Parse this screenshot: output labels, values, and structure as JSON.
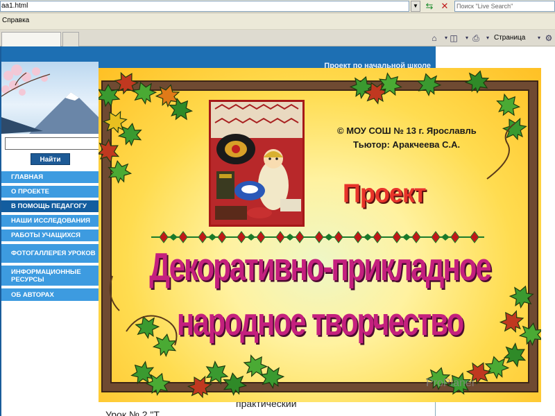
{
  "browser": {
    "address_value": "aa1.html",
    "search_placeholder": "Поиск \"Live Search\"",
    "menu_help": "Справка",
    "toolbar_page_label": "Страница",
    "icons": [
      "home-icon",
      "feed-icon",
      "print-icon",
      "page-icon",
      "refresh-icon",
      "stop-icon"
    ]
  },
  "site": {
    "header_title": "Проект по начальной школе",
    "search_button": "Найти",
    "nav": [
      {
        "label": "ГЛАВНАЯ",
        "active": false
      },
      {
        "label": "О ПРОЕКТЕ",
        "active": false
      },
      {
        "label": "В ПОМОЩЬ ПЕДАГОГУ",
        "active": true
      },
      {
        "label": "НАШИ ИССЛЕДОВАНИЯ",
        "active": false
      },
      {
        "label": "РАБОТЫ УЧАЩИХСЯ",
        "active": false
      },
      {
        "label": "ФОТОГАЛЛЕРЕЯ УРОКОВ",
        "active": false
      },
      {
        "label": "ИНФОРМАЦИОННЫЕ РЕСУРСЫ",
        "active": false
      },
      {
        "label": "ОБ АВТОРАХ",
        "active": false
      }
    ],
    "footer_line_1": "практический",
    "footer_line_2": "Урок № 2 \"Т"
  },
  "slide": {
    "author_line_1": "©  МОУ СОШ № 13 г. Ярославль",
    "author_line_2": "Тьютор: Аракчеева С.А.",
    "project_word": "Проект",
    "title_line_1": "Декоративно-прикладное",
    "title_line_2": "народное творчество"
  },
  "watermark": "ProPlaner",
  "colors": {
    "site_blue": "#1d6fb3",
    "nav_blue": "#3d9be0",
    "nav_active": "#135d9f",
    "frame_wood": "#6f4a32",
    "title_magenta": "#c4207e",
    "project_red": "#e8342a"
  }
}
